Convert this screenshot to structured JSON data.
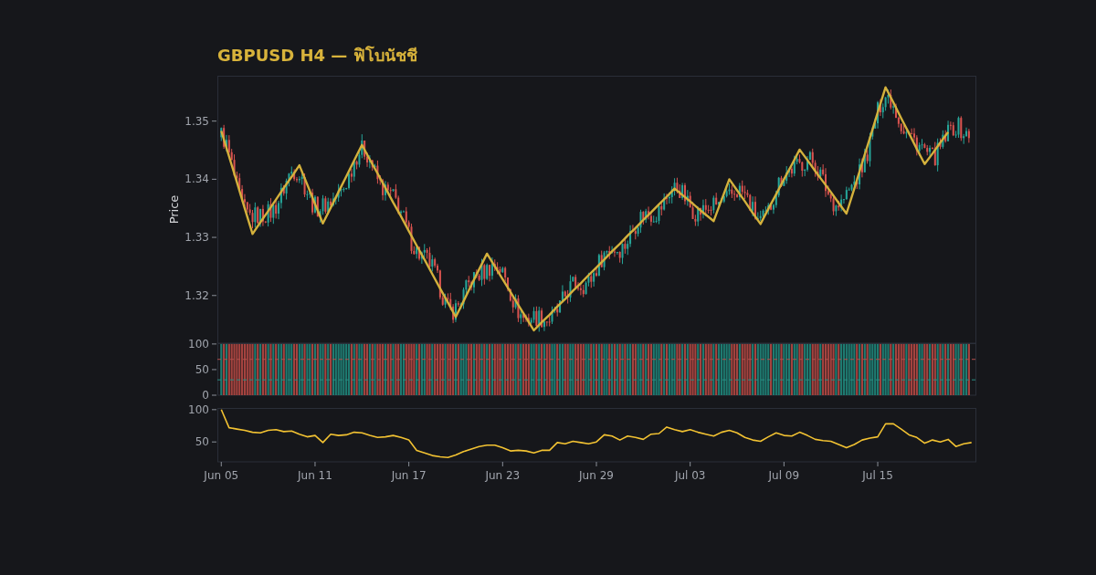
{
  "title": "GBPUSD H4 — ฟิโบนัชชี",
  "price_panel": {
    "chart_data": {
      "type": "line",
      "ylabel": "Price",
      "ylim": [
        1.3118,
        1.3578
      ],
      "yticks": [
        {
          "value": 1.32,
          "label": "1.32"
        },
        {
          "value": 1.33,
          "label": "1.33"
        },
        {
          "value": 1.34,
          "label": "1.34"
        },
        {
          "value": 1.35,
          "label": "1.35"
        }
      ],
      "categories": [
        null,
        null,
        null,
        null,
        null,
        null,
        null,
        null,
        null,
        null,
        null,
        null,
        null,
        null,
        null,
        null,
        null,
        null,
        null,
        null,
        null,
        null,
        null,
        null,
        null,
        null,
        null,
        null,
        null,
        null,
        null,
        null,
        null,
        null,
        null,
        null,
        null,
        null,
        null,
        null,
        null,
        null,
        null,
        null,
        null,
        null,
        null,
        null,
        null,
        null,
        null,
        null,
        null,
        null,
        null,
        null,
        null,
        null,
        null,
        null,
        null,
        null,
        null,
        null,
        null,
        null,
        null,
        null,
        null,
        null,
        null,
        null,
        null,
        null,
        null,
        null,
        null,
        null,
        null,
        null,
        null,
        null,
        null,
        null,
        null,
        null,
        null,
        null,
        null,
        null,
        null,
        null,
        null,
        null,
        null,
        null,
        null
      ],
      "series": [
        {
          "color": "#d4b13c",
          "values": [
            1.3483,
            1.3439,
            1.3395,
            1.335,
            1.3306,
            1.3326,
            1.3345,
            1.3365,
            1.3385,
            1.3404,
            1.3424,
            1.3391,
            1.3357,
            1.3324,
            1.3351,
            1.3378,
            1.3405,
            1.3432,
            1.3459,
            1.3434,
            1.341,
            1.3385,
            1.336,
            1.3336,
            1.3311,
            1.3286,
            1.3262,
            1.3237,
            1.3212,
            1.3188,
            1.3163,
            1.319,
            1.3218,
            1.3245,
            1.3272,
            1.325,
            1.3228,
            1.3206,
            1.3184,
            1.3162,
            1.314,
            1.3154,
            1.3167,
            1.3181,
            1.3194,
            1.3208,
            1.3221,
            1.3235,
            1.3248,
            1.3262,
            1.3276,
            1.3289,
            1.3303,
            1.3316,
            1.333,
            1.3343,
            1.3357,
            1.337,
            1.3384,
            1.3373,
            1.3362,
            1.335,
            1.3339,
            1.3328,
            1.3364,
            1.34,
            1.3381,
            1.3362,
            1.3342,
            1.3323,
            1.3349,
            1.3374,
            1.34,
            1.3425,
            1.3451,
            1.3433,
            1.3414,
            1.3396,
            1.3378,
            1.3359,
            1.3341,
            1.3384,
            1.3428,
            1.3471,
            1.3515,
            1.3558,
            1.3532,
            1.3505,
            1.3479,
            1.3452,
            1.3426,
            1.3444,
            1.3463,
            1.3481,
            null,
            null,
            null
          ]
        }
      ]
    },
    "candles": [
      {
        "kind": "rising",
        "color": "#26a69a"
      },
      {
        "kind": "falling",
        "color": "#d9534f"
      }
    ]
  },
  "bar_panel": {
    "chart_data": {
      "type": "bar",
      "ylim": [
        0,
        101.6
      ],
      "yticks": [
        {
          "value": 0,
          "label": "0"
        },
        {
          "value": 50,
          "label": "50"
        },
        {
          "value": 100,
          "label": "100"
        }
      ],
      "ref_lines": [
        {
          "axis": "y",
          "value": 70,
          "color": "#b5504c"
        },
        {
          "axis": "y",
          "value": 30,
          "color": "#2a8f84"
        }
      ],
      "categories": [
        null,
        null,
        null,
        null,
        null,
        null,
        null,
        null,
        null,
        null,
        null,
        null,
        null,
        null,
        null,
        null,
        null,
        null,
        null,
        null,
        null,
        null,
        null,
        null,
        null,
        null,
        null,
        null,
        null,
        null,
        null,
        null,
        null,
        null,
        null,
        null,
        null,
        null,
        null,
        null,
        null,
        null,
        null,
        null,
        null,
        null,
        null,
        null,
        null,
        null,
        null,
        null,
        null,
        null,
        null,
        null,
        null,
        null,
        null,
        null,
        null,
        null,
        null,
        null,
        null,
        null,
        null,
        null,
        null,
        null,
        null,
        null,
        null,
        null,
        null,
        null,
        null,
        null,
        null,
        null,
        null,
        null,
        null,
        null,
        null,
        null,
        null,
        null,
        null,
        null,
        null,
        null,
        null,
        null,
        null,
        null,
        null
      ]
    },
    "bars": [
      {
        "kind": "rising",
        "color": "#1e7b71"
      },
      {
        "kind": "falling",
        "color": "#a5433f"
      }
    ]
  },
  "line_panel": {
    "chart_data": {
      "type": "line",
      "ylim": [
        19.2,
        102.6
      ],
      "yticks": [
        {
          "value": 50,
          "label": "50"
        },
        {
          "value": 100,
          "label": "100"
        }
      ],
      "categories": [
        "Jun 05",
        null,
        null,
        null,
        null,
        null,
        null,
        null,
        null,
        null,
        null,
        null,
        "Jun 11",
        null,
        null,
        null,
        null,
        null,
        null,
        null,
        null,
        null,
        null,
        null,
        "Jun 17",
        null,
        null,
        null,
        null,
        null,
        null,
        null,
        null,
        null,
        null,
        null,
        "Jun 23",
        null,
        null,
        null,
        null,
        null,
        null,
        null,
        null,
        null,
        null,
        null,
        "Jun 29",
        null,
        null,
        null,
        null,
        null,
        null,
        null,
        null,
        null,
        null,
        null,
        "Jul 03",
        null,
        null,
        null,
        null,
        null,
        null,
        null,
        null,
        null,
        null,
        null,
        "Jul 09",
        null,
        null,
        null,
        null,
        null,
        null,
        null,
        null,
        null,
        null,
        null,
        "Jul 15",
        null,
        null,
        null,
        null,
        null,
        null,
        null,
        null,
        null,
        null,
        null,
        null
      ],
      "series": [
        {
          "color": "#f2c232",
          "values": [
            100,
            72,
            70,
            68,
            65,
            64,
            68,
            69,
            66,
            67,
            62,
            58,
            60,
            49,
            62,
            60,
            61,
            65,
            64,
            60,
            57,
            58,
            60,
            57,
            53,
            37,
            33,
            29,
            27,
            26,
            30,
            35,
            39,
            43,
            45,
            45,
            41,
            36,
            37,
            36,
            33,
            37,
            37,
            49,
            47,
            51,
            49,
            47,
            50,
            61,
            59,
            53,
            59,
            57,
            54,
            62,
            63,
            73,
            69,
            66,
            69,
            65,
            62,
            59,
            65,
            68,
            64,
            57,
            53,
            51,
            58,
            64,
            60,
            59,
            65,
            60,
            54,
            52,
            51,
            46,
            41,
            46,
            53,
            56,
            58,
            78,
            78,
            70,
            61,
            57,
            48,
            53,
            50,
            54,
            43,
            47,
            49
          ]
        }
      ]
    }
  }
}
